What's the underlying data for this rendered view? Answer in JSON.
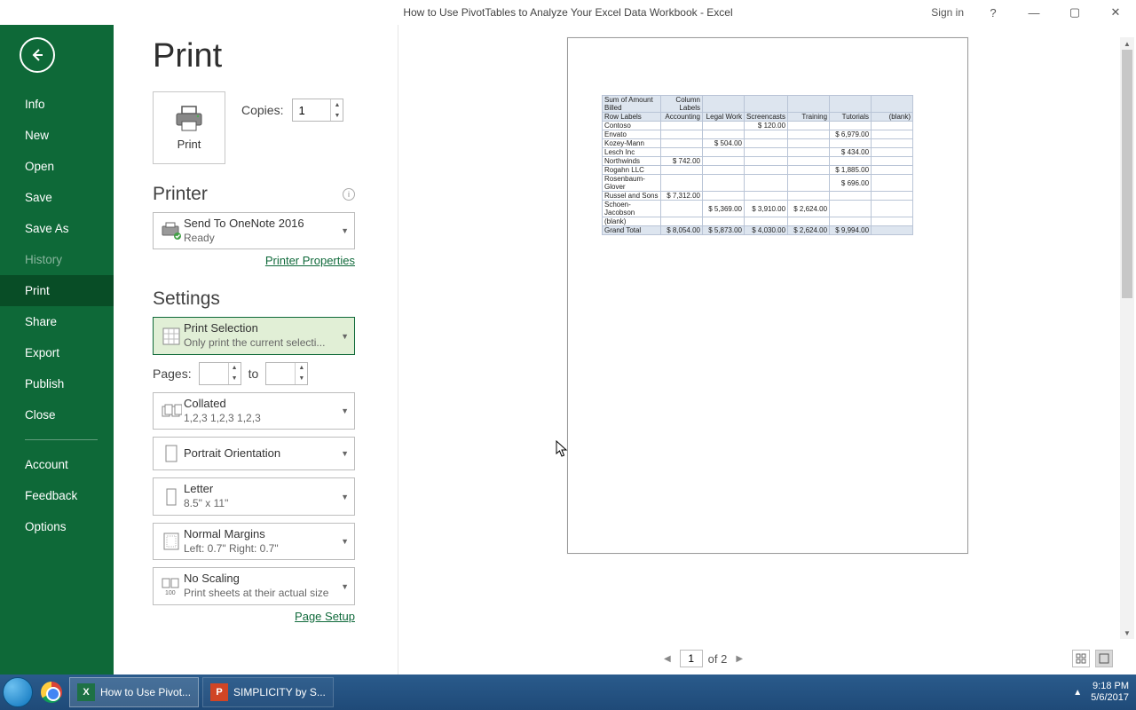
{
  "titlebar": {
    "title": "How to Use PivotTables to Analyze Your Excel Data Workbook  -  Excel",
    "signin": "Sign in"
  },
  "sidebar": {
    "items": [
      {
        "id": "info",
        "label": "Info"
      },
      {
        "id": "new",
        "label": "New"
      },
      {
        "id": "open",
        "label": "Open"
      },
      {
        "id": "save",
        "label": "Save"
      },
      {
        "id": "saveas",
        "label": "Save As"
      },
      {
        "id": "history",
        "label": "History"
      },
      {
        "id": "print",
        "label": "Print"
      },
      {
        "id": "share",
        "label": "Share"
      },
      {
        "id": "export",
        "label": "Export"
      },
      {
        "id": "publish",
        "label": "Publish"
      },
      {
        "id": "close",
        "label": "Close"
      },
      {
        "id": "account",
        "label": "Account"
      },
      {
        "id": "feedback",
        "label": "Feedback"
      },
      {
        "id": "options",
        "label": "Options"
      }
    ]
  },
  "print": {
    "title": "Print",
    "button_label": "Print",
    "copies_label": "Copies:",
    "copies_value": "1",
    "printer_heading": "Printer",
    "printer_name": "Send To OneNote 2016",
    "printer_status": "Ready",
    "printer_properties": "Printer Properties",
    "settings_heading": "Settings",
    "setting_print_area": {
      "title": "Print Selection",
      "sub": "Only print the current selecti..."
    },
    "pages_label": "Pages:",
    "pages_from": "",
    "pages_to_label": "to",
    "pages_to": "",
    "collation": {
      "title": "Collated",
      "sub": "1,2,3    1,2,3    1,2,3"
    },
    "orientation": {
      "title": "Portrait Orientation"
    },
    "paper": {
      "title": "Letter",
      "sub": "8.5\" x 11\""
    },
    "margins": {
      "title": "Normal Margins",
      "sub": "Left:  0.7\"    Right:  0.7\""
    },
    "scaling": {
      "title": "No Scaling",
      "sub": "Print sheets at their actual size"
    },
    "page_setup": "Page Setup"
  },
  "preview": {
    "current_page": "1",
    "total_pages": "of 2"
  },
  "chart_data": {
    "type": "table",
    "title_row": {
      "label": "Sum of Amount Billed",
      "col_header": "Column Labels"
    },
    "row_labels_header": "Row Labels",
    "columns": [
      "Accounting",
      "Legal Work",
      "Screencasts",
      "Training",
      "Tutorials",
      "(blank)"
    ],
    "rows": [
      {
        "label": "Contoso",
        "values": [
          "",
          "",
          "$   120.00",
          "",
          "",
          ""
        ]
      },
      {
        "label": "Envato",
        "values": [
          "",
          "",
          "",
          "",
          "$ 6,979.00",
          ""
        ]
      },
      {
        "label": "Kozey-Mann",
        "values": [
          "",
          "$   504.00",
          "",
          "",
          "",
          ""
        ]
      },
      {
        "label": "Lesch Inc",
        "values": [
          "",
          "",
          "",
          "",
          "$   434.00",
          ""
        ]
      },
      {
        "label": "Northwinds",
        "values": [
          "$       742.00",
          "",
          "",
          "",
          "",
          ""
        ]
      },
      {
        "label": "Rogahn LLC",
        "values": [
          "",
          "",
          "",
          "",
          "$ 1,885.00",
          ""
        ]
      },
      {
        "label": "Rosenbaum-Glover",
        "values": [
          "",
          "",
          "",
          "",
          "$   696.00",
          ""
        ]
      },
      {
        "label": "Russel and Sons",
        "values": [
          "$    7,312.00",
          "",
          "",
          "",
          "",
          ""
        ]
      },
      {
        "label": "Schoen-Jacobson",
        "values": [
          "",
          "$ 5,369.00",
          "$ 3,910.00",
          "$ 2,624.00",
          "",
          ""
        ]
      },
      {
        "label": "(blank)",
        "values": [
          "",
          "",
          "",
          "",
          "",
          ""
        ]
      }
    ],
    "grand_total": {
      "label": "Grand Total",
      "values": [
        "$    8,054.00",
        "$ 5,873.00",
        "$ 4,030.00",
        "$ 2,624.00",
        "$ 9,994.00",
        ""
      ]
    }
  },
  "taskbar": {
    "excel_task": "How to Use Pivot...",
    "ppt_task": "SIMPLICITY by S...",
    "time": "9:18 PM",
    "date": "5/6/2017"
  }
}
